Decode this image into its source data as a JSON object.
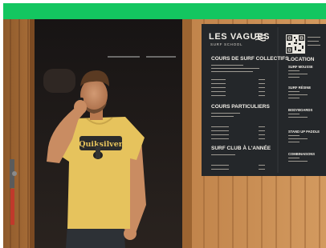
{
  "board": {
    "brand": "LES VAGUES",
    "brand_sub": "SURF SCHOOL",
    "sections": [
      "COURS DE SURF COLLECTIFS",
      "COURS PARTICULIERS",
      "SURF CLUB À L'ANNÉE"
    ],
    "location_title": "LOCATION",
    "location_items": [
      "SURF MOUSSE",
      "SURF RÉSINE",
      "BODYBOARDS",
      "STAND UP PADDLE",
      "COMBINAISONS"
    ]
  },
  "shirt": {
    "logo_text": "Quiksilver"
  },
  "colors": {
    "top_bar": "#13c660",
    "wood": "#b3773f",
    "board": "#24272a",
    "shirt": "#e6c35d"
  }
}
